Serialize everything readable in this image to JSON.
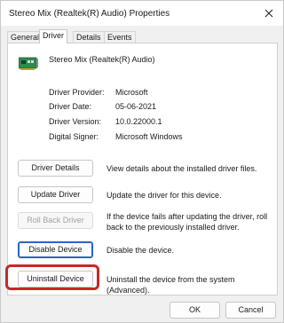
{
  "window": {
    "title": "Stereo Mix (Realtek(R) Audio) Properties"
  },
  "tabs": [
    {
      "label": "General"
    },
    {
      "label": "Driver",
      "active": true
    },
    {
      "label": "Details"
    },
    {
      "label": "Events"
    }
  ],
  "device": {
    "name": "Stereo Mix (Realtek(R) Audio)",
    "icon": "sound-card-icon"
  },
  "properties": [
    {
      "label": "Driver Provider:",
      "value": "Microsoft"
    },
    {
      "label": "Driver Date:",
      "value": "05-06-2021"
    },
    {
      "label": "Driver Version:",
      "value": "10.0.22000.1"
    },
    {
      "label": "Digital Signer:",
      "value": "Microsoft Windows"
    }
  ],
  "actions": [
    {
      "button": "Driver Details",
      "description": "View details about the installed driver files.",
      "enabled": true
    },
    {
      "button": "Update Driver",
      "description": "Update the driver for this device.",
      "enabled": true
    },
    {
      "button": "Roll Back Driver",
      "description": "If the device fails after updating the driver, roll back to the previously installed driver.",
      "enabled": false
    },
    {
      "button": "Disable Device",
      "description": "Disable the device.",
      "enabled": true,
      "focused": true
    },
    {
      "button": "Uninstall Device",
      "description": "Uninstall the device from the system (Advanced).",
      "enabled": true,
      "highlighted": true
    }
  ],
  "footer": {
    "ok_label": "OK",
    "cancel_label": "Cancel"
  },
  "colors": {
    "highlight": "#c62828",
    "focus": "#2b64c6"
  }
}
